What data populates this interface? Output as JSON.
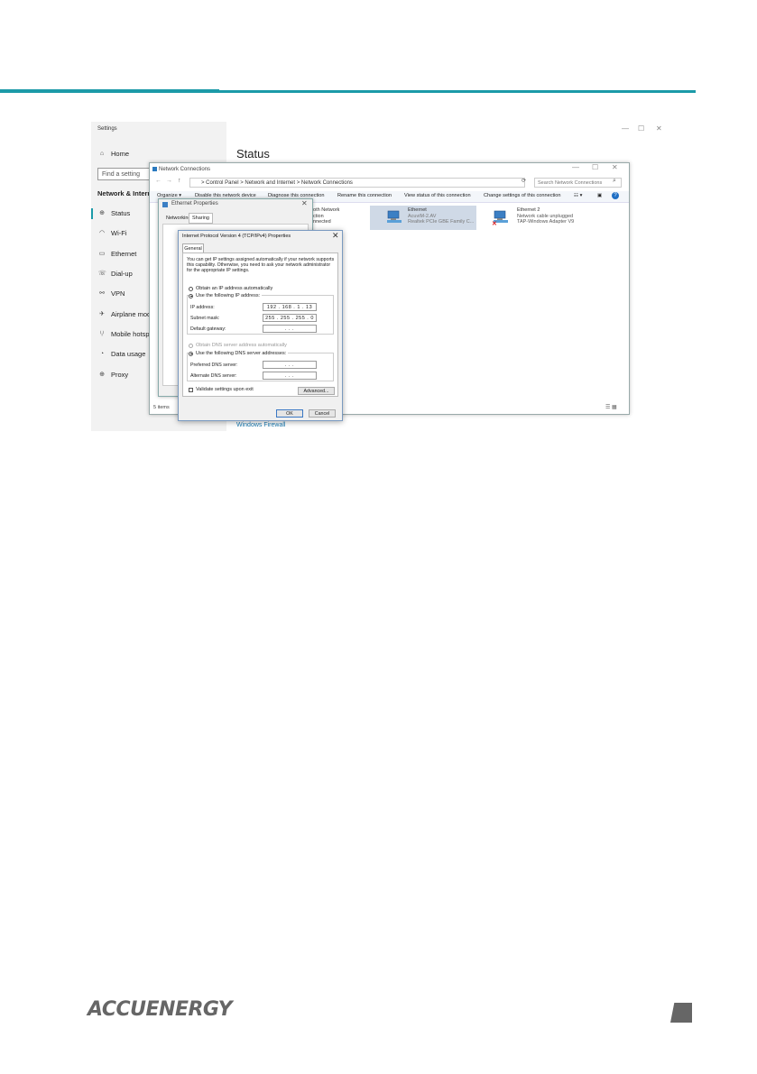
{
  "settings": {
    "title": "Settings",
    "home": "Home",
    "find_placeholder": "Find a setting",
    "section": "Network & Intern",
    "items": [
      {
        "label": "Status",
        "icon": "globe-icon"
      },
      {
        "label": "Wi-Fi",
        "icon": "wifi-icon"
      },
      {
        "label": "Ethernet",
        "icon": "ethernet-icon"
      },
      {
        "label": "Dial-up",
        "icon": "dialup-icon"
      },
      {
        "label": "VPN",
        "icon": "vpn-icon"
      },
      {
        "label": "Airplane mod",
        "icon": "airplane-icon"
      },
      {
        "label": "Mobile hotsp",
        "icon": "hotspot-icon"
      },
      {
        "label": "Data usage",
        "icon": "data-usage-icon"
      },
      {
        "label": "Proxy",
        "icon": "globe-icon"
      }
    ],
    "page_title": "Status",
    "firewall_link": "Windows Firewall"
  },
  "netconn": {
    "title": "Network Connections",
    "address": "> Control Panel > Network and Internet > Network Connections",
    "search_placeholder": "Search Network Connections",
    "toolbar": [
      "Organize ▾",
      "Disable this network device",
      "Diagnose this connection",
      "Rename this connection",
      "View status of this connection",
      "Change settings of this connection"
    ],
    "conn_partial": [
      "ooth Network",
      "ection",
      "onnected"
    ],
    "ethernet": {
      "name": "Ethernet",
      "line2": "AcuviM-2.AV",
      "line3": "Realtek PCIe GBE Family C..."
    },
    "ethernet2": {
      "name": "Ethernet 2",
      "line2": "Network cable unplugged",
      "line3": "TAP-Windows Adapter V9"
    },
    "footer": "5 items"
  },
  "ethprops": {
    "title": "Ethernet Properties",
    "tabs": [
      "Networking",
      "Sharing"
    ]
  },
  "ipv4": {
    "title": "Internet Protocol Version 4 (TCP/IPv4) Properties",
    "tab": "General",
    "description": "You can get IP settings assigned automatically if your network supports this capability. Otherwise, you need to ask your network administrator for the appropriate IP settings.",
    "opt_auto_ip": "Obtain an IP address automatically",
    "opt_manual_ip": "Use the following IP address:",
    "ip_label": "IP address:",
    "ip_value": "192 . 168 . 1 . 13",
    "mask_label": "Subnet mask:",
    "mask_value": "255 . 255 . 255 . 0",
    "gw_label": "Default gateway:",
    "gw_value": ". . .",
    "opt_auto_dns": "Obtain DNS server address automatically",
    "opt_manual_dns": "Use the following DNS server addresses:",
    "pref_dns_label": "Preferred DNS server:",
    "pref_dns_value": ". . .",
    "alt_dns_label": "Alternate DNS server:",
    "alt_dns_value": ". . .",
    "validate_label": "Validate settings upon exit",
    "advanced_label": "Advanced...",
    "ok_label": "OK",
    "cancel_label": "Cancel"
  },
  "footer": {
    "logo": "ACCUENERGY"
  },
  "colors": {
    "accent": "#1b9aa8",
    "logo": "#666666"
  }
}
